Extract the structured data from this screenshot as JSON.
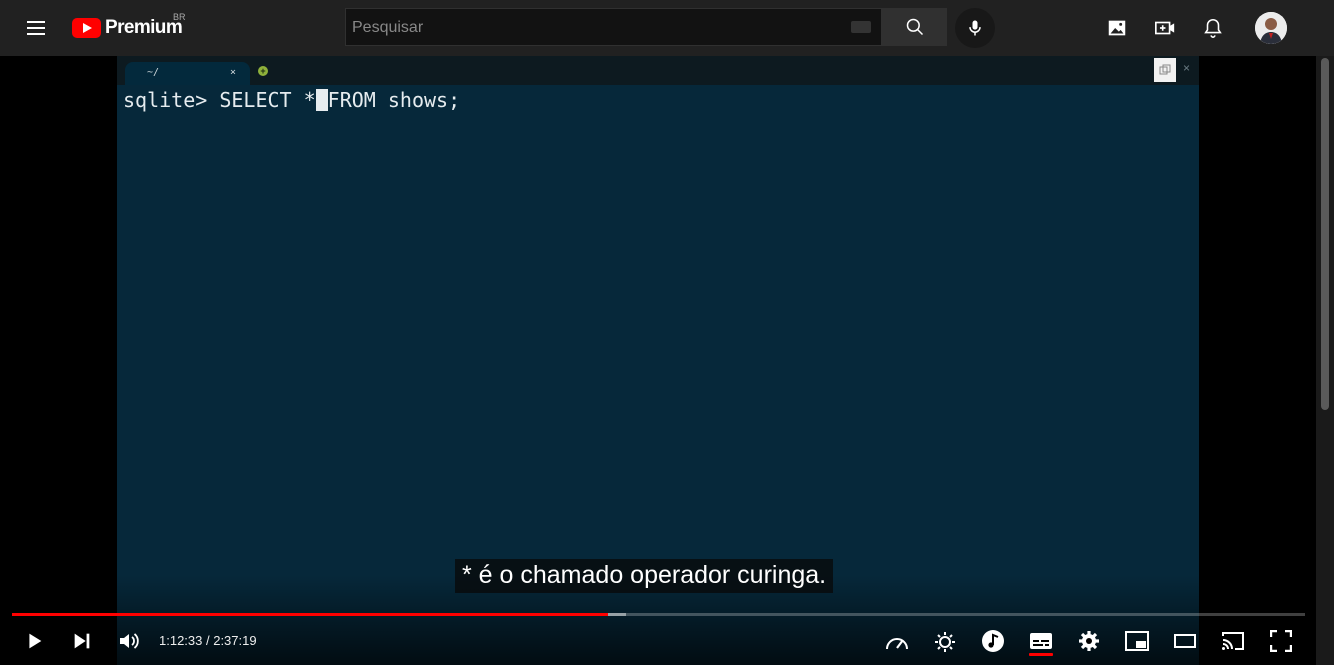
{
  "header": {
    "logo_text": "Premium",
    "country_code": "BR",
    "search_placeholder": "Pesquisar"
  },
  "terminal": {
    "tab_label": "~/",
    "tab_close": "×",
    "window_close": "×",
    "prompt": "sqlite> SELECT *",
    "after_cursor": "FROM shows;"
  },
  "player": {
    "caption": "* é o chamado operador curinga.",
    "current_time": "1:12:33",
    "duration": "2:37:19",
    "time_display": "1:12:33 / 2:37:19",
    "progress_played": 0.461,
    "progress_loaded": 0.475
  },
  "colors": {
    "accent": "#ff0000",
    "terminal_bg": "#06283a",
    "topbar_bg": "#212121"
  }
}
